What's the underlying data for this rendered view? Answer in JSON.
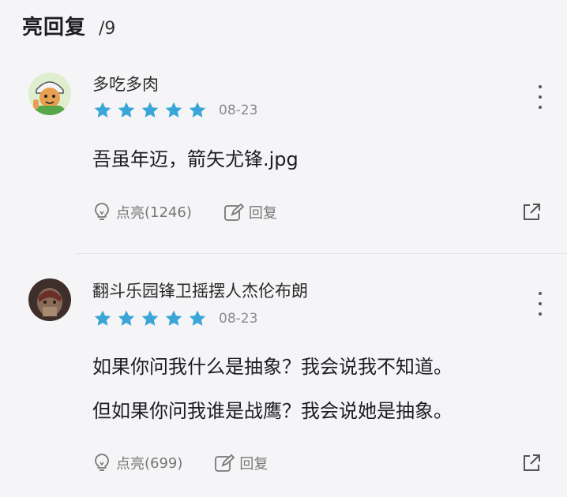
{
  "header": {
    "title": "亮回复",
    "count": "/9"
  },
  "comments": [
    {
      "username": "多吃多肉",
      "rating": 5,
      "date": "08-23",
      "content_lines": [
        "吾虽年迈，箭矢尤锋.jpg"
      ],
      "like_label": "点亮",
      "like_count": "(1246)",
      "reply_label": "回复"
    },
    {
      "username": "翻斗乐园锋卫摇摆人杰伦布朗",
      "rating": 5,
      "date": "08-23",
      "content_lines": [
        "如果你问我什么是抽象？我会说我不知道。",
        "但如果你问我谁是战鹰？我会说她是抽象。"
      ],
      "like_label": "点亮",
      "like_count": "(699)",
      "reply_label": "回复"
    }
  ],
  "colors": {
    "star": "#3aa6d8",
    "muted": "#777777"
  },
  "icons": [
    "star-icon",
    "more-icon",
    "light-bulb-icon",
    "edit-reply-icon",
    "share-icon"
  ]
}
